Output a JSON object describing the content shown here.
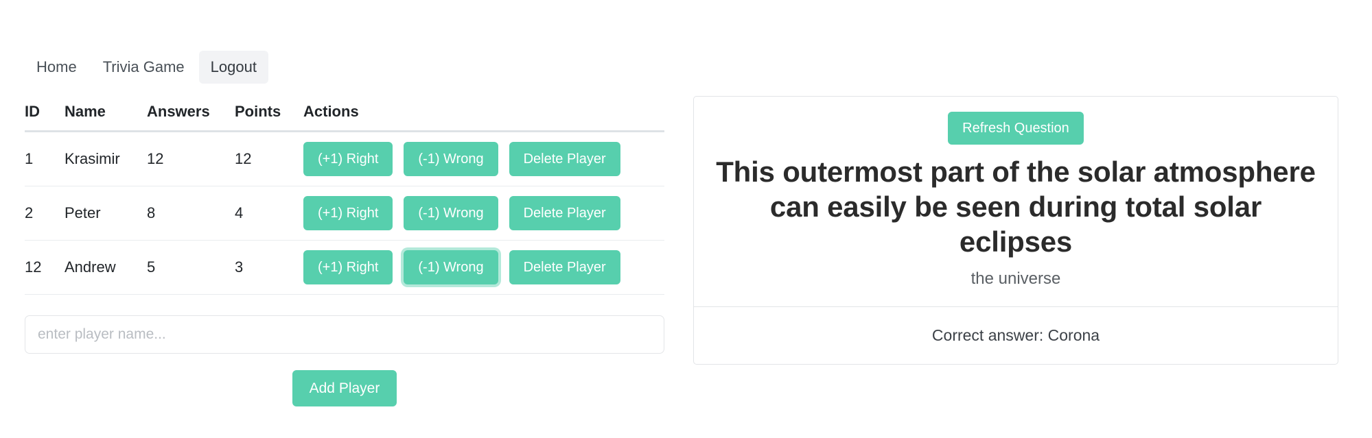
{
  "nav": {
    "items": [
      {
        "label": "Home",
        "active": false
      },
      {
        "label": "Trivia Game",
        "active": false
      },
      {
        "label": "Logout",
        "active": true
      }
    ]
  },
  "players_table": {
    "columns": [
      "ID",
      "Name",
      "Answers",
      "Points",
      "Actions"
    ],
    "rows": [
      {
        "id": "1",
        "name": "Krasimir",
        "answers": "12",
        "points": "12",
        "right_label": "(+1) Right",
        "wrong_label": "(-1) Wrong",
        "delete_label": "Delete Player"
      },
      {
        "id": "2",
        "name": "Peter",
        "answers": "8",
        "points": "4",
        "right_label": "(+1) Right",
        "wrong_label": "(-1) Wrong",
        "delete_label": "Delete Player"
      },
      {
        "id": "12",
        "name": "Andrew",
        "answers": "5",
        "points": "3",
        "right_label": "(+1) Right",
        "wrong_label": "(-1) Wrong",
        "delete_label": "Delete Player"
      }
    ]
  },
  "add_player": {
    "input_value": "",
    "input_placeholder": "enter player name...",
    "button_label": "Add Player"
  },
  "question_card": {
    "refresh_label": "Refresh Question",
    "question": "This outermost part of the solar atmosphere can easily be seen during total solar eclipses",
    "category": "the universe",
    "correct_answer_text": "Correct answer: Corona"
  },
  "colors": {
    "accent": "#57cfad",
    "nav_active_bg": "#f2f3f5",
    "card_border": "#e2e4e7"
  }
}
